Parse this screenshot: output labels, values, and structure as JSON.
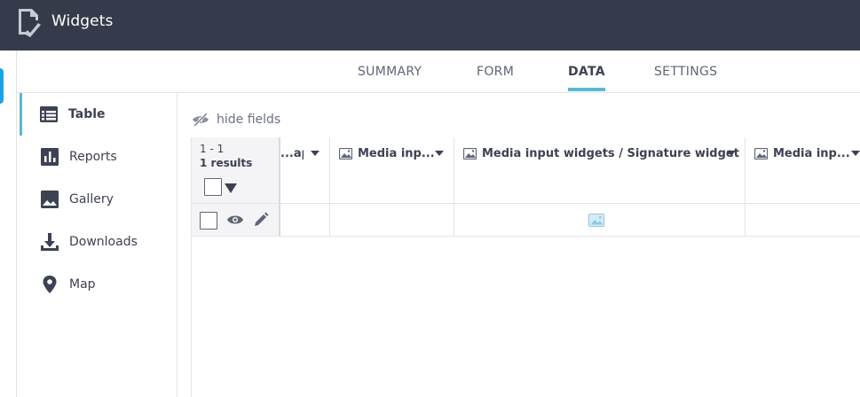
{
  "app": {
    "title": "Widgets",
    "logo_icon": "form-document-icon"
  },
  "tabs": [
    {
      "label": "SUMMARY",
      "active": false
    },
    {
      "label": "FORM",
      "active": false
    },
    {
      "label": "DATA",
      "active": true
    },
    {
      "label": "SETTINGS",
      "active": false
    }
  ],
  "sidebar": {
    "items": [
      {
        "label": "Table",
        "icon": "table-icon",
        "active": true
      },
      {
        "label": "Reports",
        "icon": "bar-chart-icon",
        "active": false
      },
      {
        "label": "Gallery",
        "icon": "image-icon",
        "active": false
      },
      {
        "label": "Downloads",
        "icon": "download-icon",
        "active": false
      },
      {
        "label": "Map",
        "icon": "map-pin-icon",
        "active": false
      }
    ]
  },
  "toolbar": {
    "hide_fields_label": "hide fields",
    "hide_fields_icon": "eye-slash-icon"
  },
  "table": {
    "range": "1 - 1",
    "results": "1 results",
    "columns": [
      {
        "label": "...ap...",
        "icon": ""
      },
      {
        "label": "Media inp...",
        "icon": "image-icon"
      },
      {
        "label": "Media input widgets / Signature widget",
        "icon": "image-icon"
      },
      {
        "label": "Media inp...",
        "icon": "image-icon"
      }
    ],
    "rows": [
      {
        "cells": [
          "",
          "",
          "image-thumbnail",
          ""
        ]
      }
    ]
  },
  "colors": {
    "topbar": "#363b4c",
    "accent": "#5ab8d3",
    "text": "#3d4252"
  }
}
